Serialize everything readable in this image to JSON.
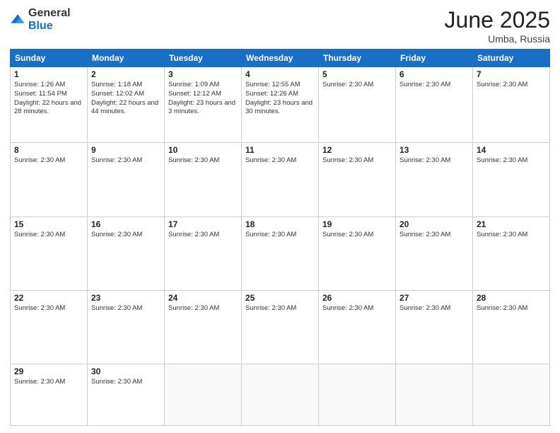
{
  "logo": {
    "general": "General",
    "blue": "Blue"
  },
  "header": {
    "month": "June 2025",
    "location": "Umba, Russia"
  },
  "weekdays": [
    "Sunday",
    "Monday",
    "Tuesday",
    "Wednesday",
    "Thursday",
    "Friday",
    "Saturday"
  ],
  "weeks": [
    [
      {
        "day": "1",
        "info": "Sunrise: 1:26 AM\nSunset: 11:54 PM\nDaylight: 22 hours\nand 28 minutes."
      },
      {
        "day": "2",
        "info": "Sunrise: 1:18 AM\nSunset: 12:02 AM\nDaylight: 22 hours\nand 44 minutes."
      },
      {
        "day": "3",
        "info": "Sunrise: 1:09 AM\nSunset: 12:12 AM\nDaylight: 23 hours\nand 3 minutes."
      },
      {
        "day": "4",
        "info": "Sunrise: 12:55 AM\nSunset: 12:26 AM\nDaylight: 23 hours\nand 30 minutes."
      },
      {
        "day": "5",
        "info": "Sunrise: 2:30 AM"
      },
      {
        "day": "6",
        "info": "Sunrise: 2:30 AM"
      },
      {
        "day": "7",
        "info": "Sunrise: 2:30 AM"
      }
    ],
    [
      {
        "day": "8",
        "info": "Sunrise: 2:30 AM"
      },
      {
        "day": "9",
        "info": "Sunrise: 2:30 AM"
      },
      {
        "day": "10",
        "info": "Sunrise: 2:30 AM"
      },
      {
        "day": "11",
        "info": "Sunrise: 2:30 AM"
      },
      {
        "day": "12",
        "info": "Sunrise: 2:30 AM"
      },
      {
        "day": "13",
        "info": "Sunrise: 2:30 AM"
      },
      {
        "day": "14",
        "info": "Sunrise: 2:30 AM"
      }
    ],
    [
      {
        "day": "15",
        "info": "Sunrise: 2:30 AM"
      },
      {
        "day": "16",
        "info": "Sunrise: 2:30 AM"
      },
      {
        "day": "17",
        "info": "Sunrise: 2:30 AM"
      },
      {
        "day": "18",
        "info": "Sunrise: 2:30 AM"
      },
      {
        "day": "19",
        "info": "Sunrise: 2:30 AM"
      },
      {
        "day": "20",
        "info": "Sunrise: 2:30 AM"
      },
      {
        "day": "21",
        "info": "Sunrise: 2:30 AM"
      }
    ],
    [
      {
        "day": "22",
        "info": "Sunrise: 2:30 AM"
      },
      {
        "day": "23",
        "info": "Sunrise: 2:30 AM"
      },
      {
        "day": "24",
        "info": "Sunrise: 2:30 AM"
      },
      {
        "day": "25",
        "info": "Sunrise: 2:30 AM"
      },
      {
        "day": "26",
        "info": "Sunrise: 2:30 AM"
      },
      {
        "day": "27",
        "info": "Sunrise: 2:30 AM"
      },
      {
        "day": "28",
        "info": "Sunrise: 2:30 AM"
      }
    ],
    [
      {
        "day": "29",
        "info": "Sunrise: 2:30 AM"
      },
      {
        "day": "30",
        "info": "Sunrise: 2:30 AM"
      },
      {
        "day": "",
        "info": ""
      },
      {
        "day": "",
        "info": ""
      },
      {
        "day": "",
        "info": ""
      },
      {
        "day": "",
        "info": ""
      },
      {
        "day": "",
        "info": ""
      }
    ]
  ]
}
